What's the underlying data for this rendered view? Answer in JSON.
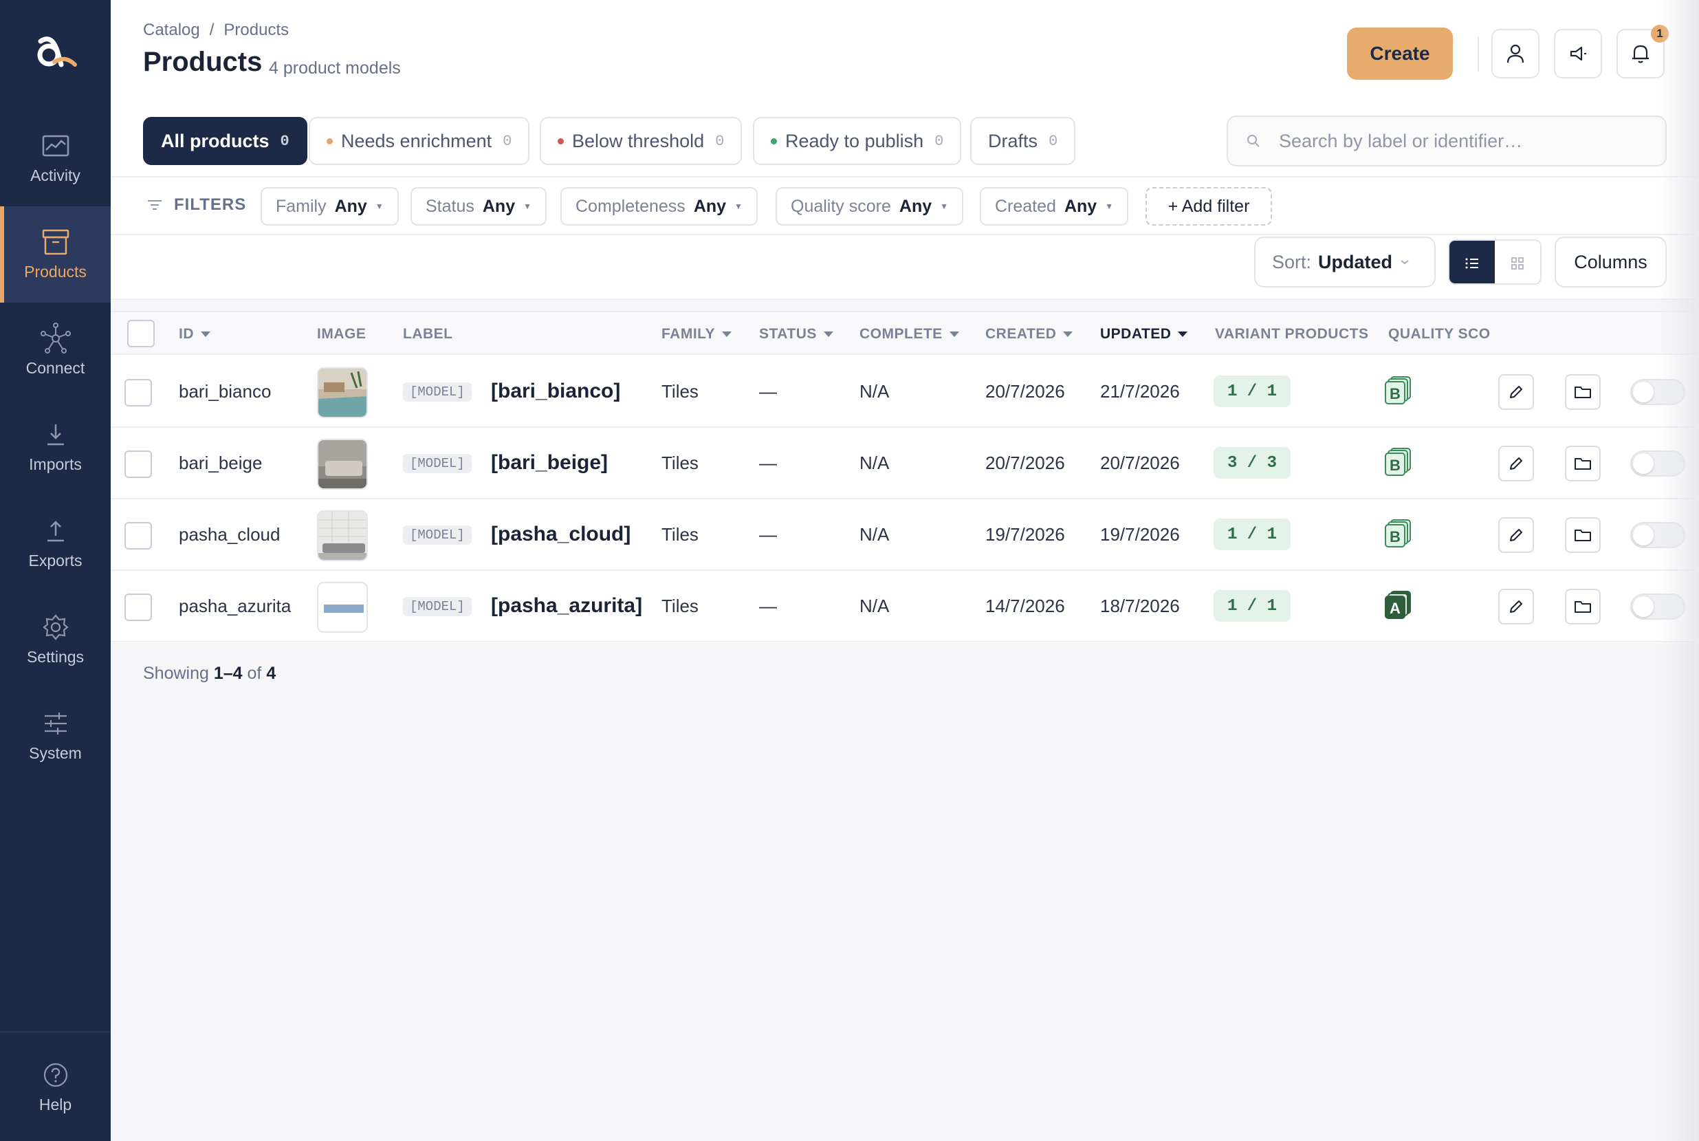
{
  "sidebar": {
    "items": [
      {
        "label": "Activity",
        "icon": "activity-icon"
      },
      {
        "label": "Products",
        "icon": "products-icon",
        "active": true
      },
      {
        "label": "Connect",
        "icon": "connect-icon"
      },
      {
        "label": "Imports",
        "icon": "import-icon"
      },
      {
        "label": "Exports",
        "icon": "export-icon"
      },
      {
        "label": "Settings",
        "icon": "settings-icon"
      },
      {
        "label": "System",
        "icon": "system-icon"
      }
    ],
    "help": {
      "label": "Help",
      "icon": "help-icon"
    }
  },
  "header": {
    "breadcrumb": [
      "Catalog",
      "/",
      "Products"
    ],
    "title": "Products",
    "subtitle": "4 product models",
    "create_label": "Create",
    "notification_count": "1"
  },
  "views": [
    {
      "label": "All products",
      "count": "0",
      "active": true
    },
    {
      "label": "Needs enrichment",
      "count": "0",
      "dot_color": "#e7a46a"
    },
    {
      "label": "Below threshold",
      "count": "0",
      "dot_color": "#d9534f"
    },
    {
      "label": "Ready to publish",
      "count": "0",
      "dot_color": "#3aa86b"
    },
    {
      "label": "Drafts",
      "count": "0"
    }
  ],
  "search": {
    "placeholder": "Search by label or identifier…",
    "value": ""
  },
  "filters": {
    "label": "FILTERS",
    "chips": [
      {
        "name": "Family",
        "value": "Any"
      },
      {
        "name": "Status",
        "value": "Any"
      },
      {
        "name": "Completeness",
        "value": "Any"
      },
      {
        "name": "Quality score",
        "value": "Any"
      },
      {
        "name": "Created",
        "value": "Any"
      }
    ],
    "add_label": "+ Add filter"
  },
  "toolbar": {
    "sort_prefix": "Sort:",
    "sort_value": "Updated",
    "columns_label": "Columns"
  },
  "table": {
    "columns": [
      "ID",
      "IMAGE",
      "LABEL",
      "FAMILY",
      "STATUS",
      "COMPLETE",
      "CREATED",
      "UPDATED",
      "VARIANT PRODUCTS",
      "QUALITY SCO"
    ],
    "model_tag": "[MODEL]",
    "rows": [
      {
        "id": "bari_bianco",
        "label": "[bari_bianco]",
        "family": "Tiles",
        "status": "—",
        "complete": "N/A",
        "created": "20/7/2026",
        "updated": "21/7/2026",
        "variants": "1 / 1",
        "quality": "B"
      },
      {
        "id": "bari_beige",
        "label": "[bari_beige]",
        "family": "Tiles",
        "status": "—",
        "complete": "N/A",
        "created": "20/7/2026",
        "updated": "20/7/2026",
        "variants": "3 / 3",
        "quality": "B"
      },
      {
        "id": "pasha_cloud",
        "label": "[pasha_cloud]",
        "family": "Tiles",
        "status": "—",
        "complete": "N/A",
        "created": "19/7/2026",
        "updated": "19/7/2026",
        "variants": "1 / 1",
        "quality": "B"
      },
      {
        "id": "pasha_azurita",
        "label": "[pasha_azurita]",
        "family": "Tiles",
        "status": "—",
        "complete": "N/A",
        "created": "14/7/2026",
        "updated": "18/7/2026",
        "variants": "1 / 1",
        "quality": "A"
      }
    ]
  },
  "footer": {
    "showing_prefix": "Showing",
    "range": "1–4",
    "of": "of",
    "total": "4"
  },
  "colors": {
    "sidebar": "#1d2a47",
    "accent": "#e7ac6b",
    "quality_b": "#3d8a5a",
    "quality_a": "#2f5e3d"
  }
}
